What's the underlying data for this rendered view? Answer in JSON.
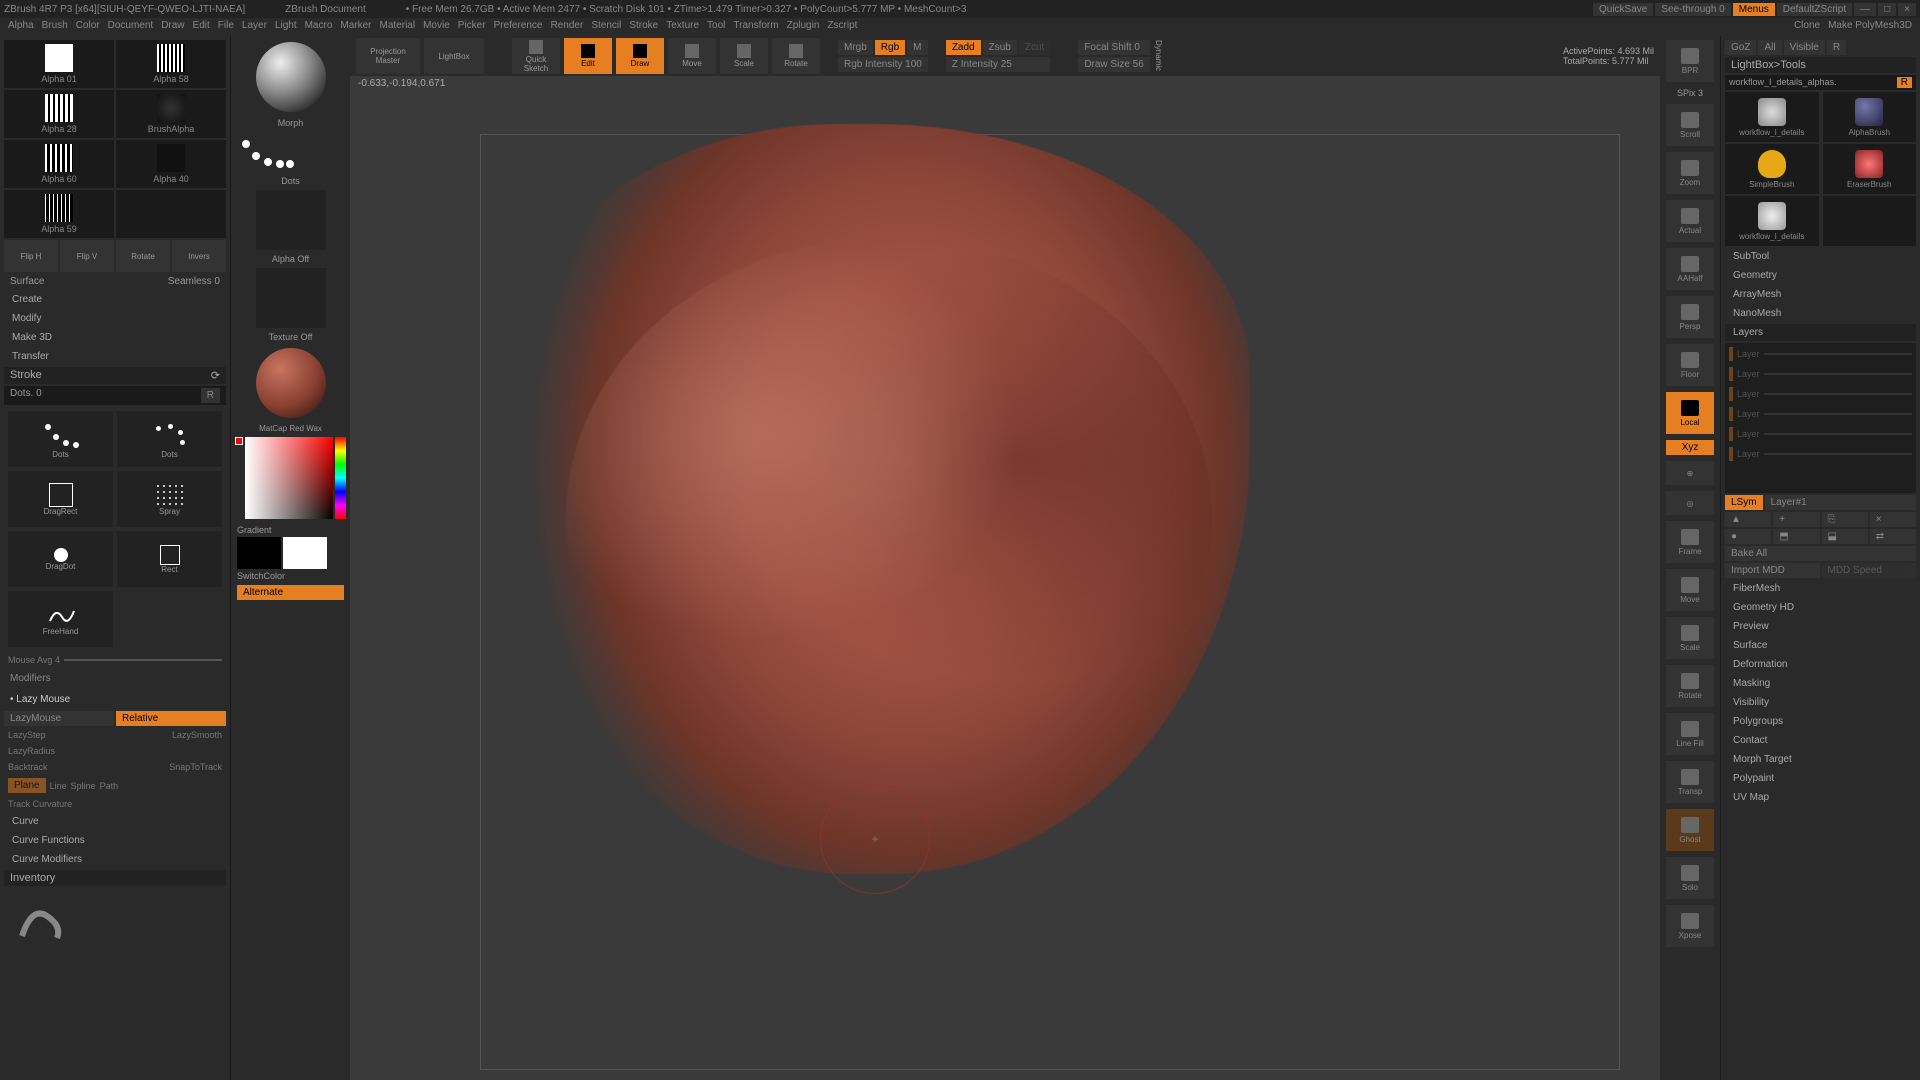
{
  "title": "ZBrush 4R7 P3 [x64][SIUH-QEYF-QWEO-LJTI-NAEA]",
  "doc": "ZBrush Document",
  "meminfo": "•  Free Mem 26.7GB  •  Active Mem 2477  •  Scratch Disk 101  •  ZTime>1.479  Timer>0.327  •  PolyCount>5.777 MP  •  MeshCount>3",
  "tr": {
    "quicksave": "QuickSave",
    "seethrough": "See-through  0",
    "menus": "Menus",
    "default": "DefaultZScript"
  },
  "menu": [
    "Alpha",
    "Brush",
    "Color",
    "Document",
    "Draw",
    "Edit",
    "File",
    "Layer",
    "Light",
    "Macro",
    "Marker",
    "Material",
    "Movie",
    "Picker",
    "Preference",
    "Render",
    "Stencil",
    "Stroke",
    "Texture",
    "Tool",
    "Transform",
    "Zplugin",
    "Zscript"
  ],
  "menu_right": {
    "clone": "Clone",
    "make": "Make PolyMesh3D"
  },
  "alphas": [
    "Alpha 01",
    "Alpha 58",
    "Alpha 28",
    "Alpha 60",
    "BrushAlpha",
    "Alpha 59",
    "Alpha 40"
  ],
  "transform_row": [
    "Flip H",
    "Flip V",
    "Rotate",
    "Invers"
  ],
  "surface_label": "Surface",
  "seamless": "Seamless 0",
  "create_items": [
    "Create",
    "Modify",
    "Make 3D",
    "Transfer"
  ],
  "stroke": {
    "title": "Stroke",
    "dots": "Dots. 0",
    "types": [
      "Dots",
      "Dots",
      "DragDot",
      "Spray",
      "FreeHand",
      "Rect"
    ],
    "dragrect": "DragRect",
    "mouseavg": "Mouse Avg 4",
    "modifiers": "Modifiers",
    "lazymouse": "• Lazy Mouse",
    "lazybtn": "LazyMouse",
    "relative": "Relative",
    "lazystep": "LazyStep",
    "lazysmooth": "LazySmooth",
    "lazyradius": "LazyRadius",
    "backtrack": "Backtrack",
    "snap": "SnapToTrack",
    "plane": "Plane",
    "line": "Line",
    "spline": "Spline",
    "path": "Path",
    "trackcurv": "Track Curvature",
    "curve": "Curve",
    "curvefns": "Curve Functions",
    "curvemods": "Curve Modifiers",
    "inventory": "Inventory"
  },
  "left2": {
    "morph": "Morph",
    "dots": "Dots",
    "alphaoff": "Alpha Off",
    "texoff": "Texture Off",
    "matcap": "MatCap Red Wax",
    "gradient": "Gradient",
    "switchcolor": "SwitchColor",
    "alternate": "Alternate"
  },
  "top": {
    "projection": "Projection\nMaster",
    "lightbox": "LightBox",
    "quicksketch": "Quick\nSketch",
    "edit": "Edit",
    "draw": "Draw",
    "move": "Move",
    "scale": "Scale",
    "rotate": "Rotate",
    "mrgb": "Mrgb",
    "rgb": "Rgb",
    "m": "M",
    "rgbint": "Rgb Intensity 100",
    "zadd": "Zadd",
    "zsub": "Zsub",
    "zcut": "Zcut",
    "zint": "Z Intensity 25",
    "focal": "Focal Shift 0",
    "drawsize": "Draw Size 56",
    "dynamic": "Dynamic",
    "active": "ActivePoints: 4.693 Mil",
    "total": "TotalPoints: 5.777 Mil"
  },
  "status": "-0.633,-0.194,0.671",
  "rightstrip": [
    "BPR",
    "SPix 3",
    "Scroll",
    "Zoom",
    "Actual",
    "AAHalf",
    "Persp",
    "Floor",
    "Local",
    "Xyz",
    "",
    "",
    "Frame",
    "Move",
    "Scale",
    "Rotate",
    "Line Fill",
    "Transp",
    "Ghost",
    "Solo",
    "Xpose"
  ],
  "rightpanel": {
    "goz": "GoZ",
    "all": "All",
    "visible": "Visible",
    "r": "R",
    "header": "LightBox>Tools",
    "tool": "workflow_I_details_alphas.",
    "thumbs": [
      "workflow_I_details",
      "AlphaBrush",
      "SimpleBrush",
      "EraserBrush",
      "workflow_I_details"
    ],
    "sections": [
      "SubTool",
      "Geometry",
      "ArrayMesh",
      "NanoMesh"
    ],
    "layers": "Layers",
    "layer_names": [
      "Layer",
      "Layer",
      "Layer",
      "Layer",
      "Layer",
      "Layer"
    ],
    "layer_sel": "Layer#1",
    "lsym": "LSym",
    "bake": "Bake All",
    "import": "Import MDD",
    "mddspeed": "MDD Speed",
    "sections2": [
      "FiberMesh",
      "Geometry HD",
      "Preview",
      "Surface",
      "Deformation",
      "Masking",
      "Visibility",
      "Polygroups",
      "Contact",
      "Morph Target",
      "Polypaint",
      "UV Map"
    ]
  }
}
